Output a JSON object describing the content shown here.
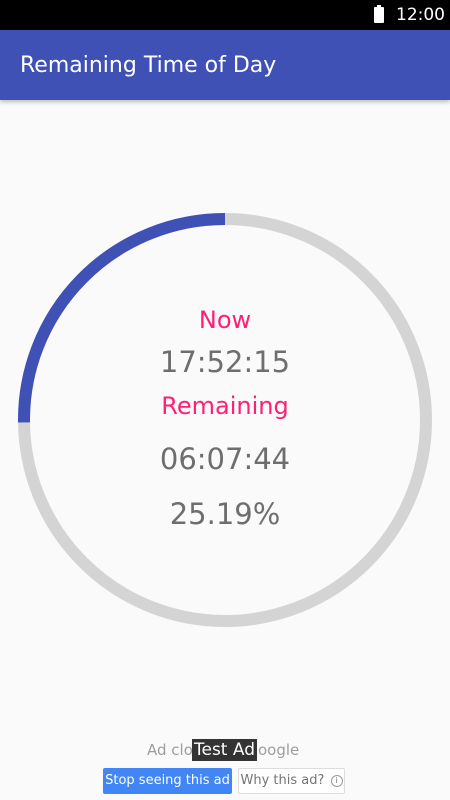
{
  "status_bar": {
    "time": "12:00"
  },
  "app": {
    "title": "Remaining Time of Day"
  },
  "timer": {
    "now_label": "Now",
    "now_value": "17:52:15",
    "remaining_label": "Remaining",
    "remaining_value": "06:07:44",
    "percent_text": "25.19%",
    "progress_fraction": 0.2519
  },
  "ad": {
    "text_left": "Ad clo",
    "text_right": "oogle",
    "badge": "Test Ad",
    "stop_button": "Stop seeing this ad",
    "why_button": "Why this ad?",
    "info_glyph": "i"
  },
  "colors": {
    "app_bar": "#3f51b5",
    "progress": "#3f51b5",
    "track": "#d4d4d4",
    "label_accent": "#ff1f77",
    "value_text": "#6e6e6e"
  }
}
